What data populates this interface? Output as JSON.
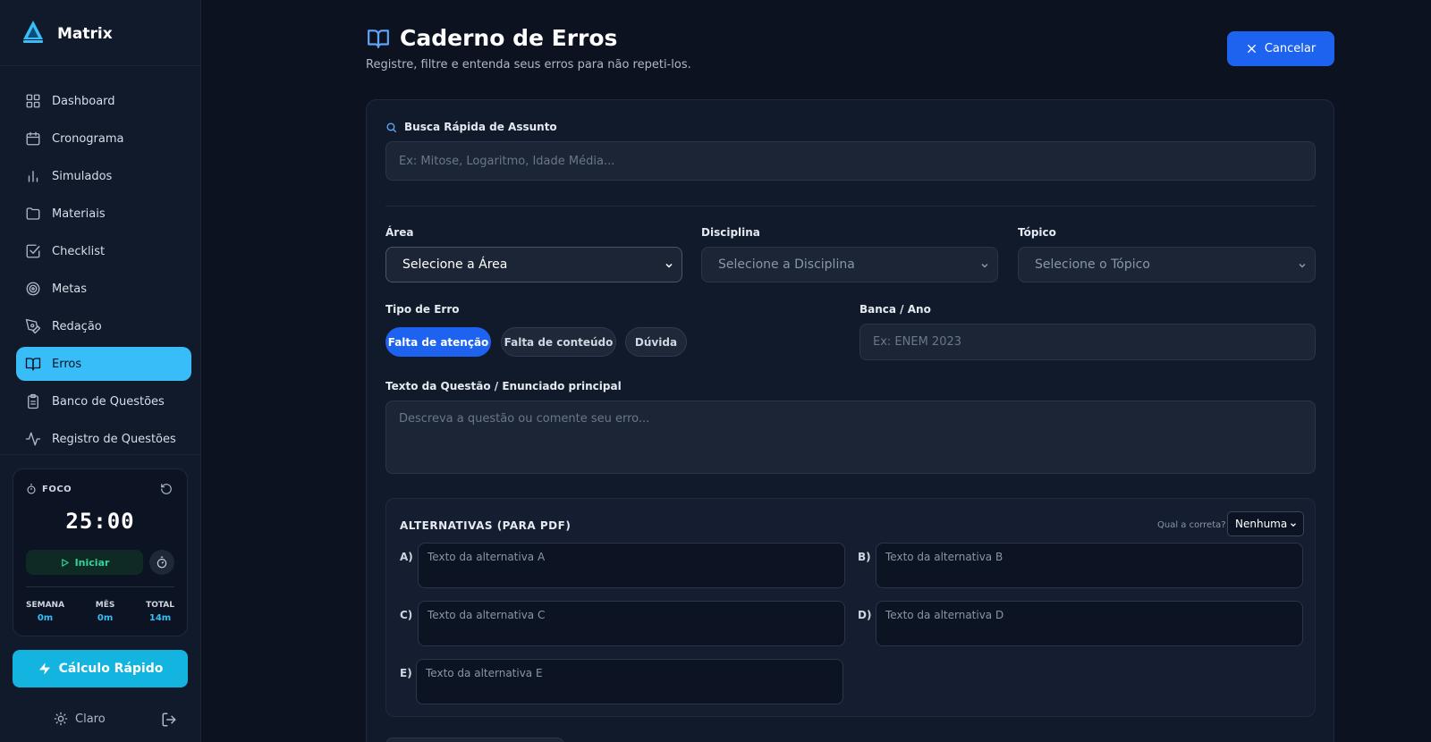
{
  "brand": {
    "name": "Matrix",
    "accent": "#38bdf8"
  },
  "sidebar": {
    "items": [
      {
        "label": "Dashboard",
        "icon": "dashboard-icon"
      },
      {
        "label": "Cronograma",
        "icon": "calendar-icon"
      },
      {
        "label": "Simulados",
        "icon": "bar-chart-icon"
      },
      {
        "label": "Materiais",
        "icon": "folder-icon"
      },
      {
        "label": "Checklist",
        "icon": "checkbox-icon"
      },
      {
        "label": "Metas",
        "icon": "target-icon"
      },
      {
        "label": "Redação",
        "icon": "pen-icon"
      },
      {
        "label": "Erros",
        "icon": "book-open-icon",
        "active": true
      },
      {
        "label": "Banco de Questões",
        "icon": "clipboard-icon"
      },
      {
        "label": "Registro de Questões",
        "icon": "activity-icon"
      }
    ]
  },
  "focus": {
    "label": "FOCO",
    "timer": "25:00",
    "start_label": "Iniciar",
    "stats": [
      {
        "label": "SEMANA",
        "value": "0m"
      },
      {
        "label": "MÊS",
        "value": "0m"
      },
      {
        "label": "TOTAL",
        "value": "14m"
      }
    ]
  },
  "quick_calc_label": "Cálculo Rápido",
  "theme_label": "Claro",
  "header": {
    "title": "Caderno de Erros",
    "subtitle": "Registre, filtre e entenda seus erros para não repeti-los.",
    "cancel_label": "Cancelar"
  },
  "form": {
    "search_label": "Busca Rápida de Assunto",
    "search_placeholder": "Ex: Mitose, Logaritmo, Idade Média...",
    "area_label": "Área",
    "area_value": "Selecione a Área",
    "discipline_label": "Disciplina",
    "discipline_value": "Selecione a Disciplina",
    "topic_label": "Tópico",
    "topic_value": "Selecione o Tópico",
    "error_type_label": "Tipo de Erro",
    "error_types": [
      "Falta de atenção",
      "Falta de conteúdo",
      "Dúvida"
    ],
    "selected_error_type": "Falta de atenção",
    "exam_label": "Banca / Ano",
    "exam_placeholder": "Ex: ENEM 2023",
    "question_label": "Texto da Questão / Enunciado principal",
    "question_placeholder": "Descreva a questão ou comente seu erro..."
  },
  "alternatives": {
    "title": "ALTERNATIVAS (PARA PDF)",
    "correct_label": "Qual a correta?",
    "correct_value": "Nenhuma",
    "items": [
      {
        "letter": "A)",
        "placeholder": "Texto da alternativa A"
      },
      {
        "letter": "B)",
        "placeholder": "Texto da alternativa B"
      },
      {
        "letter": "C)",
        "placeholder": "Texto da alternativa C"
      },
      {
        "letter": "D)",
        "placeholder": "Texto da alternativa D"
      },
      {
        "letter": "E)",
        "placeholder": "Texto da alternativa E"
      }
    ]
  }
}
